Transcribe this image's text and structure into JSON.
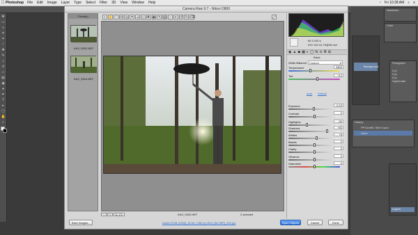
{
  "menubar": {
    "apple": "",
    "app": "Photoshop",
    "items": [
      "File",
      "Edit",
      "Image",
      "Layer",
      "Type",
      "Select",
      "Filter",
      "3D",
      "View",
      "Window",
      "Help"
    ],
    "clock": "Fri 10:28 AM"
  },
  "dialog": {
    "title": "Camera Raw 9.7 - Nikon D800",
    "filmstrip_header": "Filmstrip",
    "thumbs": [
      {
        "label": "KAS_9302.NEF",
        "stars": "· · · · ·"
      },
      {
        "label": "KAS_9344.NEF",
        "stars": "· · · · ·"
      }
    ],
    "zoom": "11.1%",
    "filename": "KAS_9302.NEF",
    "selected_count": "2 selected",
    "workflow_link": "Adobe RGB (1998); 16 bit; 7360 by 4912 (36.2MP); 300 ppi",
    "buttons": {
      "save": "Save Images...",
      "open": "Open Objects",
      "cancel": "Cancel",
      "done": "Done"
    }
  },
  "histogram_info": {
    "line1": "f/8   1/100 s",
    "line2": "ISO 100   24-70@35 mm"
  },
  "basic_panel": {
    "header": "Basic",
    "wb_label": "White Balance:",
    "wb_value": "Custom",
    "auto": "Auto",
    "default": "Default",
    "controls": [
      {
        "label": "Temperature",
        "value": "4800",
        "pos": 0.42
      },
      {
        "label": "Tint",
        "value": "+12",
        "pos": 0.55
      },
      {
        "label": "Exposure",
        "value": "-0.15",
        "pos": 0.48
      },
      {
        "label": "Contrast",
        "value": "0",
        "pos": 0.5
      },
      {
        "label": "Highlights",
        "value": "-30",
        "pos": 0.35
      },
      {
        "label": "Shadows",
        "value": "+50",
        "pos": 0.75
      },
      {
        "label": "Whites",
        "value": "+8",
        "pos": 0.54
      },
      {
        "label": "Blacks",
        "value": "0",
        "pos": 0.5
      },
      {
        "label": "Clarity",
        "value": "0",
        "pos": 0.5
      },
      {
        "label": "Vibrance",
        "value": "0",
        "pos": 0.5
      },
      {
        "label": "Saturation",
        "value": "0",
        "pos": 0.5
      }
    ]
  },
  "ps_right": {
    "navigator": "Swatches",
    "color": "Color",
    "layers": "Layers",
    "paragraph": "Paragraph",
    "history": "History",
    "history_item": "PPCamillC Shirt #.psd",
    "history_open": "Open"
  },
  "colors": {
    "accent": "#2d6fd6",
    "dialog_bg": "#d6d6d6"
  }
}
